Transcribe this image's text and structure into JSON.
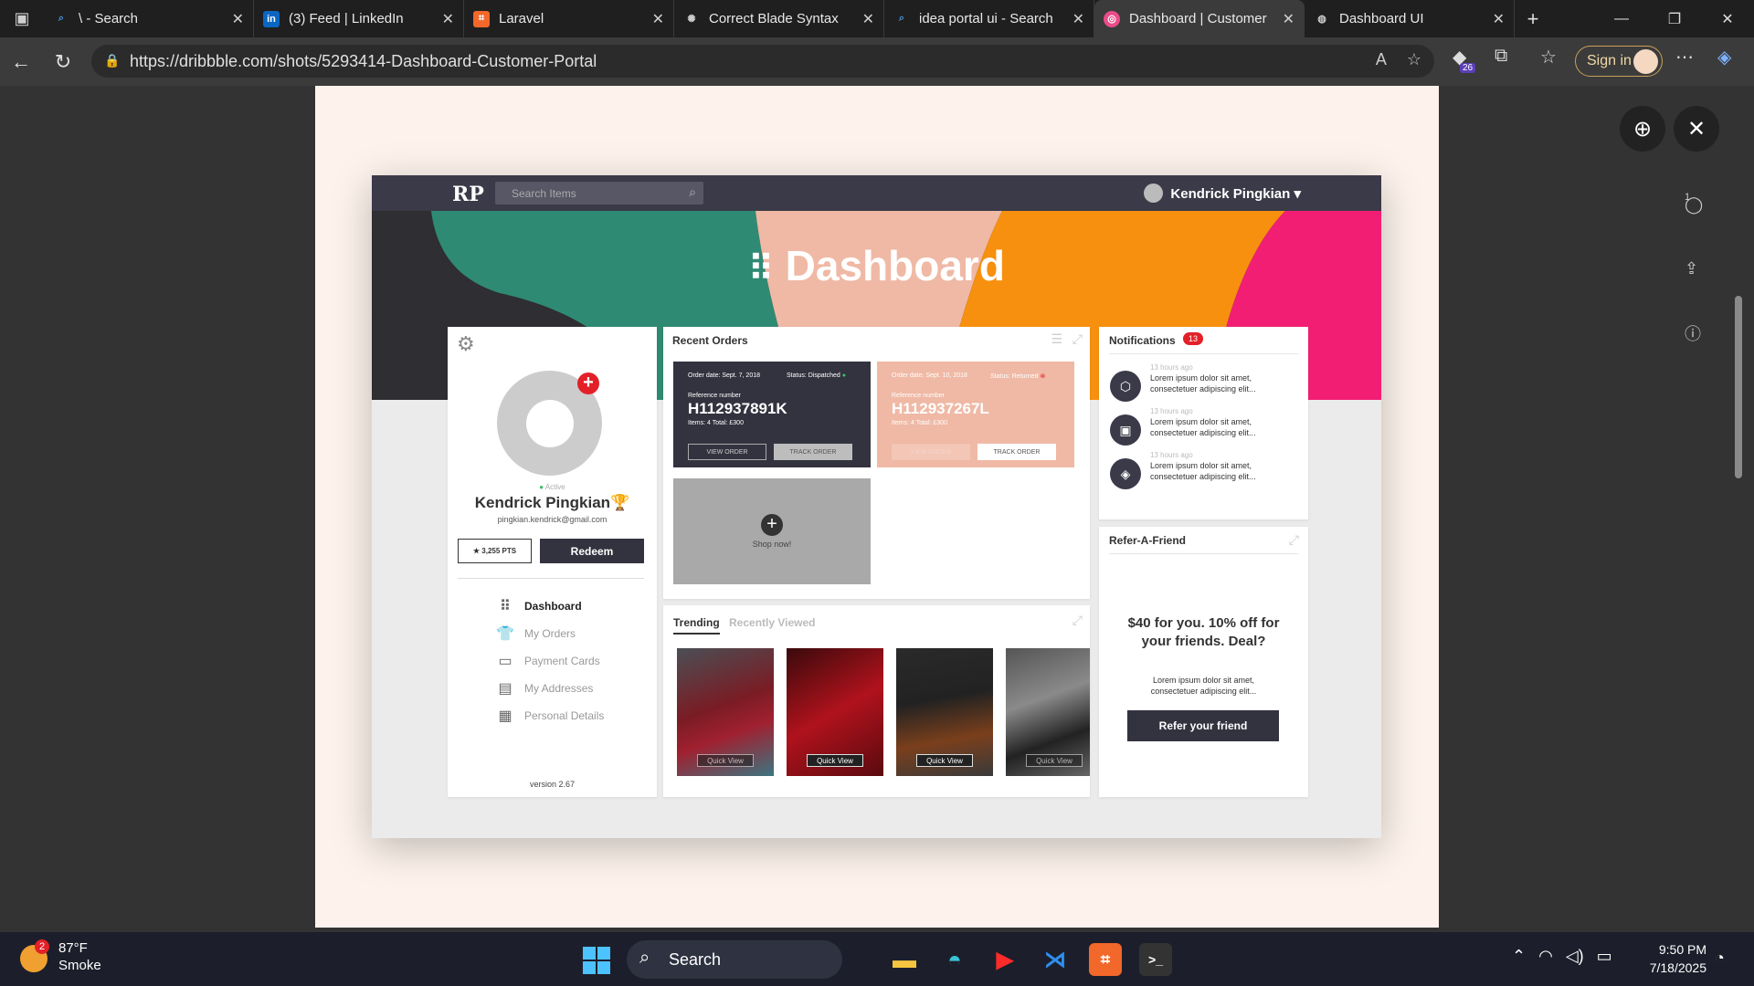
{
  "browser": {
    "tabs": [
      {
        "title": "\\ - Search",
        "icon": "search-icon",
        "color": "#2b6cb0"
      },
      {
        "title": "(3) Feed | LinkedIn",
        "icon": "linkedin-icon",
        "color": "#0a66c2"
      },
      {
        "title": "Laravel",
        "icon": "laravel-icon",
        "color": "#f2672a"
      },
      {
        "title": "Correct Blade Syntax",
        "icon": "openai-icon",
        "color": "#555555"
      },
      {
        "title": "idea portal ui - Search",
        "icon": "search-icon",
        "color": "#2b6cb0"
      },
      {
        "title": "Dashboard | Customer",
        "icon": "dribbble-icon",
        "color": "#ea4c89"
      },
      {
        "title": "Dashboard UI",
        "icon": "globe-icon",
        "color": "#555555"
      }
    ],
    "active_tab": 5,
    "url": "https://dribbble.com/shots/5293414-Dashboard-Customer-Portal",
    "extension_badge": "26",
    "sign_in": "Sign in"
  },
  "dashboard": {
    "search_placeholder": "Search Items",
    "user_name": "Kendrick Pingkian ▾",
    "title": "Dashboard",
    "profile": {
      "status": "Active",
      "name": "Kendrick Pingkian",
      "email": "pingkian.kendrick@gmail.com",
      "points": "★ 3,255 PTS",
      "redeem": "Redeem",
      "menu": [
        "Dashboard",
        "My Orders",
        "Payment Cards",
        "My Addresses",
        "Personal Details"
      ],
      "version": "version 2.67"
    },
    "recent_orders": {
      "title": "Recent Orders",
      "orders": [
        {
          "date": "Order date: Sept. 7, 2018",
          "status": "Status: Dispatched",
          "ref_label": "Reference number",
          "number": "H112937891K",
          "items": "Items: 4   Total: £300",
          "view": "VIEW ORDER",
          "track": "TRACK ORDER"
        },
        {
          "date": "Order date: Sept. 10, 2018",
          "status": "Status: Returned",
          "ref_label": "Reference number",
          "number": "H112937267L",
          "items": "Items: 4   Total: £300",
          "view": "VIEW ORDER",
          "track": "TRACK ORDER"
        }
      ],
      "shop_now": "Shop now!"
    },
    "trending": {
      "tabs": [
        "Trending",
        "Recently Viewed"
      ],
      "quick_view": "Quick View"
    },
    "notifications": {
      "title": "Notifications",
      "count": "13",
      "items": [
        {
          "ago": "13 hours ago",
          "text": "Lorem ipsum dolor sit amet, consectetuer adipiscing elit..."
        },
        {
          "ago": "13 hours ago",
          "text": "Lorem ipsum dolor sit amet, consectetuer adipiscing elit..."
        },
        {
          "ago": "13 hours ago",
          "text": "Lorem ipsum dolor sit amet, consectetuer adipiscing elit..."
        }
      ]
    },
    "refer": {
      "title": "Refer-A-Friend",
      "headline": "$40 for you. 10% off for your friends. Deal?",
      "body": "Lorem ipsum dolor sit amet, consectetuer adipiscing elit...",
      "button": "Refer your friend"
    }
  },
  "page_side": {
    "comment_count": "1"
  },
  "taskbar": {
    "weather_badge": "2",
    "temperature": "87°F",
    "condition": "Smoke",
    "search": "Search",
    "time": "9:50 PM",
    "date": "7/18/2025"
  }
}
